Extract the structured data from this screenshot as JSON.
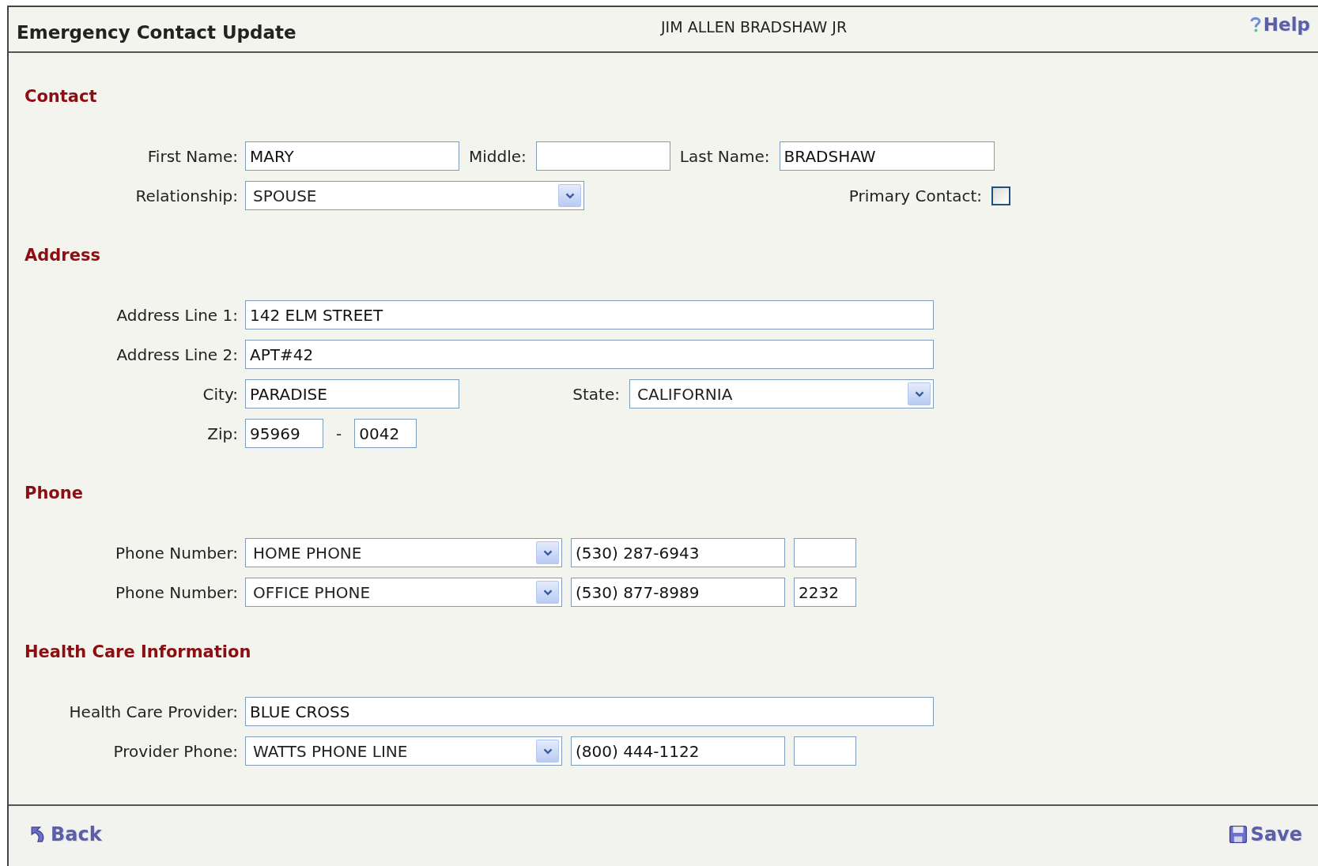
{
  "header": {
    "title": "Emergency Contact Update",
    "employee": "JIM ALLEN BRADSHAW JR",
    "help": "Help"
  },
  "sections": [
    {
      "title": "Contact",
      "rows": [
        {
          "label": "First Name:",
          "items": [
            {
              "kind": "text",
              "value": "MARY"
            },
            {
              "kind": "label",
              "text": "Middle:"
            },
            {
              "kind": "text"
            },
            {
              "kind": "label",
              "text": "Last Name:"
            },
            {
              "kind": "text",
              "value": "BRADSHAW"
            }
          ]
        },
        {
          "label": "Relationship:",
          "items": [
            {
              "kind": "select",
              "value": "SPOUSE"
            },
            {
              "kind": "label",
              "text": "Primary Contact:"
            },
            {
              "kind": "checkbox",
              "checked": false
            }
          ]
        }
      ]
    },
    {
      "title": "Address",
      "rows": [
        {
          "label": "Address Line 1:",
          "items": [
            {
              "kind": "text",
              "value": "142 ELM STREET"
            }
          ]
        },
        {
          "label": "Address Line 2:",
          "items": [
            {
              "kind": "text",
              "value": "APT#42"
            }
          ]
        },
        {
          "label": "City:",
          "items": [
            {
              "kind": "text",
              "value": "PARADISE"
            },
            {
              "kind": "label",
              "text": "State:"
            },
            {
              "kind": "select",
              "value": "CALIFORNIA"
            }
          ]
        },
        {
          "label": "Zip:",
          "items": [
            {
              "kind": "text",
              "value": "95969"
            },
            {
              "kind": "label",
              "text": "-"
            },
            {
              "kind": "text",
              "value": "0042"
            }
          ]
        }
      ]
    },
    {
      "title": "Phone",
      "rows": [
        {
          "label": "Phone Number:",
          "items": [
            {
              "kind": "select",
              "value": "HOME PHONE"
            },
            {
              "kind": "text",
              "value": "(530) 287-6943"
            },
            {
              "kind": "text"
            }
          ]
        },
        {
          "label": "Phone Number:",
          "items": [
            {
              "kind": "select",
              "value": "OFFICE PHONE"
            },
            {
              "kind": "text",
              "value": "(530) 877-8989"
            },
            {
              "kind": "text",
              "value": "2232"
            }
          ]
        }
      ]
    },
    {
      "title": "Health Care Information",
      "rows": [
        {
          "label": "Health Care Provider:",
          "items": [
            {
              "kind": "text",
              "value": "BLUE CROSS"
            }
          ]
        },
        {
          "label": "Provider Phone:",
          "items": [
            {
              "kind": "select",
              "value": "WATTS PHONE LINE"
            },
            {
              "kind": "text",
              "value": "(800) 444-1122"
            },
            {
              "kind": "text"
            }
          ]
        }
      ]
    }
  ],
  "footer": {
    "back": "Back",
    "save": "Save"
  }
}
